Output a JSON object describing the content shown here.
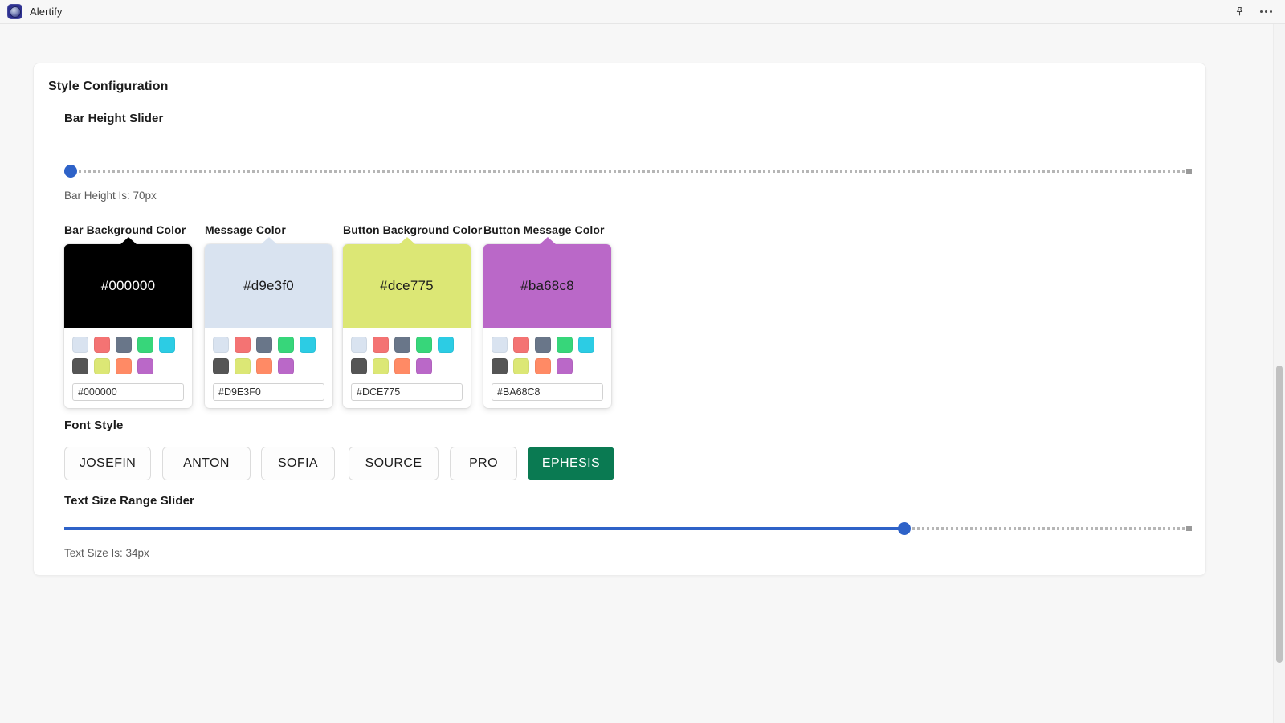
{
  "titlebar": {
    "app_name": "Alertify",
    "app_icon": "app-logo-icon",
    "pin_icon": "pin-icon",
    "more_icon": "more-options-icon"
  },
  "card": {
    "title": "Style Configuration"
  },
  "bar_height": {
    "label": "Bar Height Slider",
    "value_text": "Bar Height Is: 70px",
    "value": 70,
    "fill_percent": 0
  },
  "text_size": {
    "label": "Text Size Range Slider",
    "value_text": "Text Size Is: 34px",
    "value": 34,
    "fill_percent": 74.5
  },
  "palette": [
    "#D9E3F0",
    "#F47373",
    "#697689",
    "#37D67A",
    "#2CCCE4",
    "#555555",
    "#DCE775",
    "#FF8A65",
    "#BA68C8"
  ],
  "pickers": [
    {
      "label": "Bar Background Color",
      "display_hex": "#000000",
      "input_value": "#000000",
      "swatch_color": "#000000",
      "text_color": "#ffffff"
    },
    {
      "label": "Message Color",
      "display_hex": "#d9e3f0",
      "input_value": "#D9E3F0",
      "swatch_color": "#d9e3f0",
      "text_color": "#1c1c1c"
    },
    {
      "label": "Button Background Color",
      "display_hex": "#dce775",
      "input_value": "#DCE775",
      "swatch_color": "#dce775",
      "text_color": "#1c1c1c"
    },
    {
      "label": "Button Message Color",
      "display_hex": "#ba68c8",
      "input_value": "#BA68C8",
      "swatch_color": "#ba68c8",
      "text_color": "#1c1c1c"
    }
  ],
  "font_style": {
    "label": "Font Style",
    "selected": "EPHESIS",
    "options": [
      {
        "label": "JOSEFIN",
        "selected": false
      },
      {
        "label": "ANTON",
        "selected": false
      },
      {
        "label": "SOFIA",
        "selected": false
      },
      {
        "label": "SOURCE",
        "selected": false
      },
      {
        "label": "PRO",
        "selected": false
      },
      {
        "label": "EPHESIS",
        "selected": true
      }
    ]
  },
  "colors": {
    "accent_blue": "#2e62c8",
    "active_green": "#0a7a52",
    "page_bg": "#f7f7f7",
    "card_bg": "#ffffff"
  }
}
